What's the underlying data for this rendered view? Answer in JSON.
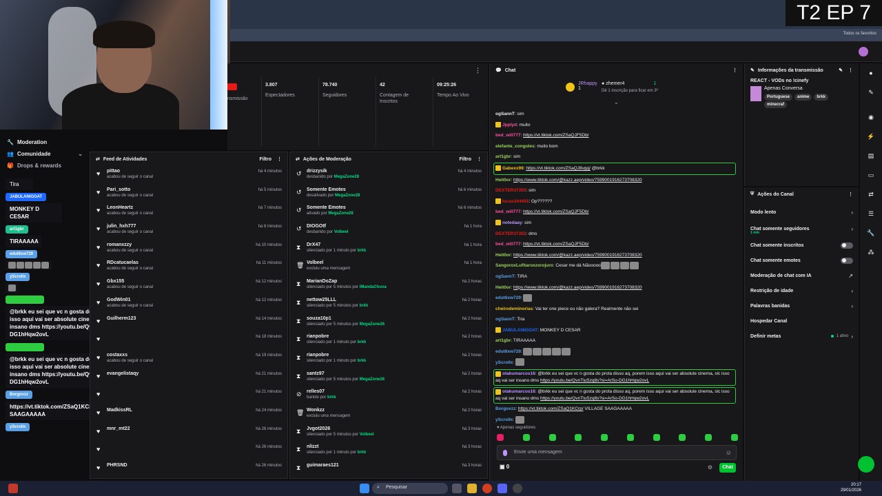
{
  "overlay_title": "T2 EP 7",
  "bookmarks_label": "Todos os favoritos",
  "stats": [
    {
      "value": "",
      "label": "nsmissão"
    },
    {
      "value": "3.807",
      "label": "Espectadores"
    },
    {
      "value": "78.740",
      "label": "Seguidores"
    },
    {
      "value": "42",
      "label": "Contagem de Inscritos"
    },
    {
      "value": "09:25:26",
      "label": "Tempo Ao Vivo"
    }
  ],
  "left_nav": [
    {
      "label": "Moderation",
      "icon": "wrench-icon"
    },
    {
      "label": "Comunidade",
      "icon": "users-icon"
    },
    {
      "label": "Drops & rewards",
      "icon": "gift-icon"
    }
  ],
  "overlay_chat": [
    {
      "name": "",
      "text": "Tira",
      "color": "#1a1a1e"
    },
    {
      "name": "JABULANIGOAT",
      "text": "MONKEY D CESAR",
      "color": "#1e69ff"
    },
    {
      "name": "art1gbr",
      "text": "TIRAAAAA",
      "color": "#1fbf8f"
    },
    {
      "name": "edut6xw729",
      "text": "",
      "color": "#5aa0e6",
      "emotes": 5
    },
    {
      "name": "yScrollx",
      "text": "",
      "color": "#5aa0e6",
      "emotes": 1
    },
    {
      "name": "otakumarcos16",
      "text": "@brkk eu sei que vc n gosta do prota disso aq, porem isso aqui vai ser absolute cinema, slc isso aq vai ser insano dms https://youtu.be/QvnTluSzq8s?si=ArSo-DG1hHqw2ovL",
      "color": "#2ecc40"
    },
    {
      "name": "otakumarcos16",
      "text": "@brkk eu sei que vc n gosta do prota disso aq, porem isso aqui vai ser absolute cinema, slc isso aq vai ser insano dms https://youtu.be/QvnTluSzq8s?si=ArSo-DG1hHqw2ovL",
      "color": "#2ecc40"
    },
    {
      "name": "Borgovzz",
      "text": "https://vt.tiktok.com/ZSaQ1KCrp/ VILLAGE SAAGAAAAA",
      "color": "#5aa0e6"
    },
    {
      "name": "yScrollx",
      "text": "",
      "color": "#5aa0e6"
    }
  ],
  "activity_feed": {
    "title": "Feed de Atividades",
    "filter": "Filtro",
    "items": [
      {
        "name": "pittao",
        "sub": "acabou de seguir o canal",
        "time": "há 4 minutos"
      },
      {
        "name": "Pari_sotto",
        "sub": "acabou de seguir o canal",
        "time": "há 5 minutos"
      },
      {
        "name": "LeonHeartz",
        "sub": "acabou de seguir o canal",
        "time": "há 7 minutos"
      },
      {
        "name": "julin_hxh777",
        "sub": "acabou de seguir o canal",
        "time": "há 8 minutos"
      },
      {
        "name": "romanxzzy",
        "sub": "acabou de seguir o canal",
        "time": "há 10 minutos"
      },
      {
        "name": "RDcatucaelas",
        "sub": "acabou de seguir o canal",
        "time": "há 11 minutos"
      },
      {
        "name": "Gbx155",
        "sub": "acabou de seguir o canal",
        "time": "há 12 minutos"
      },
      {
        "name": "GodWin01",
        "sub": "acabou de seguir o canal",
        "time": "há 12 minutos"
      },
      {
        "name": "Guilherm123",
        "sub": "",
        "time": "há 14 minutos"
      },
      {
        "name": "",
        "sub": "",
        "time": "há 18 minutos"
      },
      {
        "name": "costaxxs",
        "sub": "acabou de seguir o canal",
        "time": "há 19 minutos"
      },
      {
        "name": "evangelistaqy",
        "sub": "",
        "time": "há 21 minutos"
      },
      {
        "name": "",
        "sub": "",
        "time": "há 21 minutos"
      },
      {
        "name": "MadkissRL",
        "sub": "",
        "time": "há 24 minutos"
      },
      {
        "name": "mnr_mt22",
        "sub": "",
        "time": "há 26 minutos"
      },
      {
        "name": "",
        "sub": "",
        "time": "há 26 minutos"
      },
      {
        "name": "PHRSND",
        "sub": "",
        "time": "há 26 minutos"
      }
    ]
  },
  "mod_actions": {
    "title": "Ações de Moderação",
    "filter": "Filtro",
    "items": [
      {
        "icon": "undo-icon",
        "name": "drizzysik",
        "sub": "desbanido por",
        "by": "MegaZone28",
        "time": "há 4 minutos"
      },
      {
        "icon": "undo-icon",
        "name": "Somente Emotes",
        "sub": "desativado por",
        "by": "MegaZone28",
        "time": "há 6 minutos"
      },
      {
        "icon": "undo-icon",
        "name": "Somente Emotes",
        "sub": "ativado por",
        "by": "MegaZone28",
        "time": "há 6 minutos"
      },
      {
        "icon": "undo-icon",
        "name": "DIOGOtf",
        "sub": "desbanido por",
        "by": "Volbeel",
        "time": "há 1 hora"
      },
      {
        "icon": "hourglass-icon",
        "name": "DrX47",
        "sub": "silenciado por 1 minuto por",
        "by": "brkk",
        "time": "há 1 hora"
      },
      {
        "icon": "trash-icon",
        "name": "Volbeel",
        "sub": "excluiu uma mensagem",
        "by": "",
        "time": "há 1 hora"
      },
      {
        "icon": "hourglass-icon",
        "name": "MarianDoZap",
        "sub": "silenciado por 5 minutos por",
        "by": "iMandaChuva",
        "time": "há 2 horas"
      },
      {
        "icon": "hourglass-icon",
        "name": "nettow25LLL",
        "sub": "silenciado por 5 minutos por",
        "by": "brkk",
        "time": "há 2 horas"
      },
      {
        "icon": "hourglass-icon",
        "name": "souza10p1",
        "sub": "silenciado por 5 minutos por",
        "by": "MegaZone26",
        "time": "há 2 horas"
      },
      {
        "icon": "hourglass-icon",
        "name": "rianpobre",
        "sub": "silenciado por 1 minuto por",
        "by": "brkk",
        "time": "há 2 horas"
      },
      {
        "icon": "hourglass-icon",
        "name": "rianpobre",
        "sub": "silenciado por 1 minuto por",
        "by": "brkk",
        "time": "há 2 horas"
      },
      {
        "icon": "hourglass-icon",
        "name": "santz97",
        "sub": "silenciado por 5 minutos por",
        "by": "MegaZone26",
        "time": "há 2 horas"
      },
      {
        "icon": "ban-icon",
        "name": "relles07",
        "sub": "banido por",
        "by": "brkk",
        "time": "há 2 horas"
      },
      {
        "icon": "trash-icon",
        "name": "Wonkzz",
        "sub": "excluiu uma mensagem",
        "by": "",
        "time": "há 2 horas"
      },
      {
        "icon": "hourglass-icon",
        "name": "Jvgot2026",
        "sub": "silenciado por 5 minutos por",
        "by": "Volbeel",
        "time": "há 3 horas"
      },
      {
        "icon": "hourglass-icon",
        "name": "nlizzt",
        "sub": "silenciado por 1 minuto por",
        "by": "brkk",
        "time": "há 3 horas"
      },
      {
        "icon": "hourglass-icon",
        "name": "guimaraes121",
        "sub": "",
        "by": "",
        "time": "há 3 horas"
      }
    ]
  },
  "chat": {
    "title": "Chat",
    "hype": {
      "user1": "JRhappy",
      "user1_count": "1",
      "user2": "zhemer4",
      "user2_count": "1",
      "sub": "Dê 1 inscrição para ficar em 3º"
    },
    "lines": [
      {
        "user": "ogSannT",
        "color": "#efeff1",
        "text": ": sim",
        "link": "",
        "after": ""
      },
      {
        "user": "Jpplyd",
        "color": "#ff4fa0",
        "text": ": muito",
        "link": "",
        "after": "",
        "badge": true
      },
      {
        "user": "bed_will777",
        "color": "#ff4fa0",
        "text": ": ",
        "link": "https://vt.tiktok.com/ZSaQJF5Db/",
        "after": ""
      },
      {
        "user": "elefante_congoles",
        "color": "#9bd35a",
        "text": ": muito bom",
        "link": "",
        "after": ""
      },
      {
        "user": "art1gbr",
        "color": "#9bd35a",
        "text": ": sim",
        "link": "",
        "after": ""
      },
      {
        "user": "Gabexx99",
        "color": "#f0c419",
        "text": ": ",
        "link": "https://vt.tiktok.com/ZSaQJ8vgq/",
        "after": " @brkk",
        "hl": true,
        "badge": true
      },
      {
        "user": "Heit0or",
        "color": "#9bd35a",
        "text": ": ",
        "link": "https://www.tiktok.com/@kazz.aep/video/7599001916273708320",
        "after": ""
      },
      {
        "user": "DEXTER37355",
        "color": "#e91916",
        "text": ": sim",
        "link": "",
        "after": ""
      },
      {
        "user": "lucas344455",
        "color": "#e91916",
        "text": ": Op??????",
        "link": "",
        "after": "",
        "badge": true
      },
      {
        "user": "bed_will777",
        "color": "#ff4fa0",
        "text": ": ",
        "link": "https://vt.tiktok.com/ZSaQJF5Db/",
        "after": ""
      },
      {
        "user": "notedaay",
        "color": "#bf94ff",
        "text": ": sim",
        "link": "",
        "after": "",
        "badge": true
      },
      {
        "user": "DEXTER37355",
        "color": "#e91916",
        "text": ": dms",
        "link": "",
        "after": ""
      },
      {
        "user": "bed_will777",
        "color": "#ff4fa0",
        "text": ": ",
        "link": "https://vt.tiktok.com/ZSaQJF5Db/",
        "after": ""
      },
      {
        "user": "Heit0or",
        "color": "#9bd35a",
        "text": ": ",
        "link": "https://www.tiktok.com/@kazz.aep/video/7599001916273708320",
        "after": ""
      },
      {
        "user": "SangoroxLufitaroxzorojuro",
        "color": "#9bd35a",
        "text": ": Cesar me dá Nãooooo",
        "link": "",
        "after": "",
        "emotes": 4
      },
      {
        "user": "ogSannT",
        "color": "#5aa0e6",
        "text": ": TIRA",
        "link": "",
        "after": ""
      },
      {
        "user": "Heit0or",
        "color": "#9bd35a",
        "text": ": ",
        "link": "https://www.tiktok.com/@kazz.aep/video/7599001916273708320",
        "after": ""
      },
      {
        "user": "edut6xw729",
        "color": "#5aa0e6",
        "text": ": ",
        "link": "",
        "after": "",
        "emotes": 1
      },
      {
        "user": "cheirodeminorias",
        "color": "#f0c419",
        "text": ": Vai ter one piece ou não galera? Realmente não sei",
        "link": "",
        "after": ""
      },
      {
        "user": "ogSannT",
        "color": "#5aa0e6",
        "text": ": Tira",
        "link": "",
        "after": ""
      },
      {
        "user": "JABULANIGOAT",
        "color": "#1e69ff",
        "text": ": MONKEY D CESAR",
        "link": "",
        "after": "",
        "badge": true
      },
      {
        "user": "art1gbr",
        "color": "#9bd35a",
        "text": ": TIRAAAAA",
        "link": "",
        "after": ""
      },
      {
        "user": "edut6xw729",
        "color": "#5aa0e6",
        "text": ": ",
        "link": "",
        "after": "",
        "emotes": 5
      },
      {
        "user": "yScrollx",
        "color": "#5aa0e6",
        "text": ": ",
        "link": "",
        "after": "",
        "emotes": 1
      }
    ],
    "highlight_msgs": [
      {
        "user": "otakumarcos16",
        "text": ": @brkk eu sei que vc n gosta do prota disso aq, porem isso aqui vai ser absolute cinema, slc isso aq vai ser insano dms ",
        "link": "https://youtu.be/QvnTluSzq8s?si=ArSo-DG1hHqw2ovL"
      },
      {
        "user": "otakumarcos16",
        "text": ": @brkk eu sei que vc n gosta do prota disso aq, porem isso aqui vai ser absolute cinema, slc isso aq vai ser insano dms ",
        "link": "https://youtu.be/QvnTluSzq8s?si=ArSo-DG1hHqw2ovL"
      }
    ],
    "tail_lines": [
      {
        "user": "Borgovzz",
        "color": "#5aa0e6",
        "text": ": ",
        "link": "https://vt.tiktok.com/ZSaQ1KCrp/",
        "after": " VILLAGE SAAGAAAAA"
      },
      {
        "user": "yScrollx",
        "color": "#5aa0e6",
        "text": ": ",
        "link": "",
        "after": "",
        "emotes": 1
      }
    ],
    "only_followers": "Apenas seguidores",
    "input_placeholder": "Envie uma mensagem",
    "points": "0",
    "send_label": "Chat"
  },
  "info": {
    "title": "Informações da transmissão",
    "stream_title": "REACT - VODs no !cinefy",
    "category": "Apenas Conversa",
    "tags": [
      "Portuguese",
      "anime",
      "brkk",
      "minecraf"
    ]
  },
  "actions": {
    "title": "Ações do Canal",
    "rows": [
      {
        "label": "Modo lento",
        "type": "chevron",
        "sub": ""
      },
      {
        "label": "Chat somente seguidores",
        "type": "chevron",
        "sub": "1 min"
      },
      {
        "label": "Chat somente inscritos",
        "type": "toggle",
        "sub": ""
      },
      {
        "label": "Chat somente emotes",
        "type": "toggle",
        "sub": ""
      },
      {
        "label": "Moderação de chat com IA",
        "type": "external",
        "sub": ""
      },
      {
        "label": "Restrição de idade",
        "type": "chevron",
        "sub": ""
      },
      {
        "label": "Palavras banidas",
        "type": "chevron",
        "sub": ""
      },
      {
        "label": "Hospedar Canal",
        "type": "none",
        "sub": ""
      },
      {
        "label": "Definir metas",
        "type": "active",
        "sub": "",
        "badge": "1 ativo"
      }
    ]
  },
  "taskbar": {
    "search": "Pesquisar",
    "time": "20:17",
    "date": "29/01/2026"
  }
}
